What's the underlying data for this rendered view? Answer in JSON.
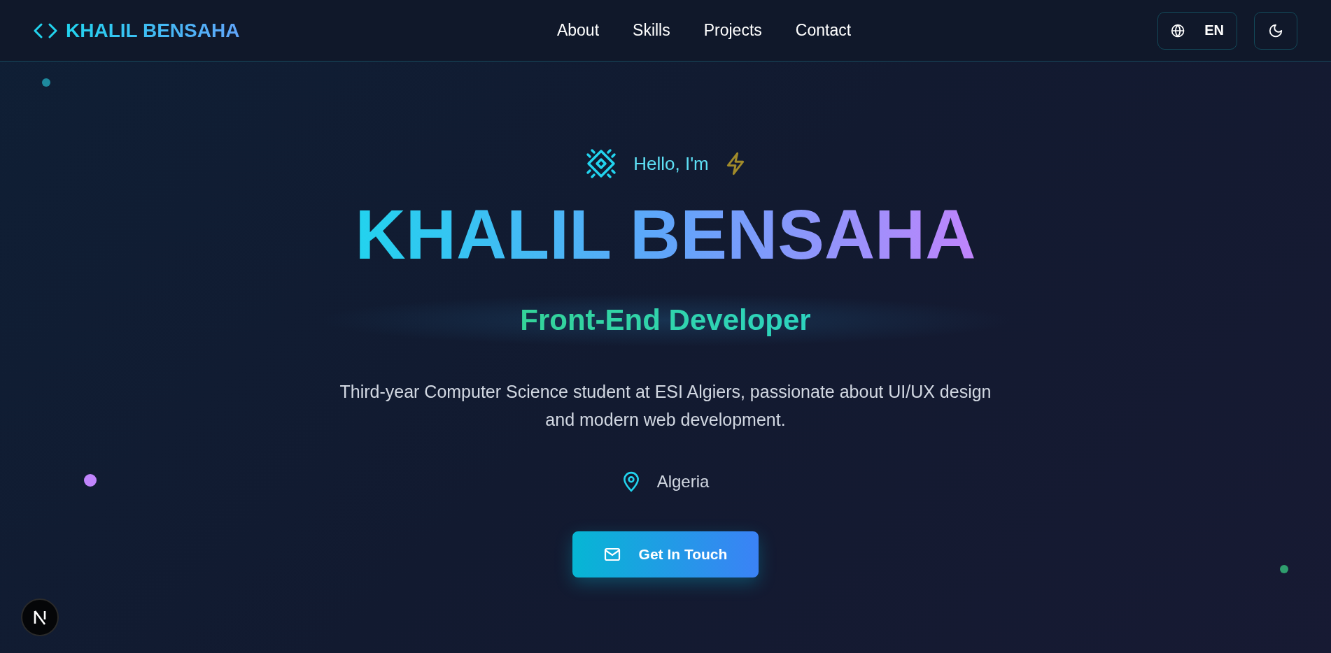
{
  "header": {
    "brand": "KHALIL BENSAHA",
    "nav": [
      {
        "label": "About"
      },
      {
        "label": "Skills"
      },
      {
        "label": "Projects"
      },
      {
        "label": "Contact"
      }
    ],
    "language": "EN"
  },
  "hero": {
    "greeting": "Hello, I'm",
    "name": "KHALIL BENSAHA",
    "role": "Front-End Developer",
    "description": "Third-year Computer Science student at ESI Algiers, passionate about UI/UX design and modern web development.",
    "location": "Algeria",
    "cta": "Get In Touch"
  },
  "dots": [
    {
      "color": "#1e8a9e"
    },
    {
      "color": "#c084fc"
    },
    {
      "color": "#2f9e6e"
    }
  ]
}
